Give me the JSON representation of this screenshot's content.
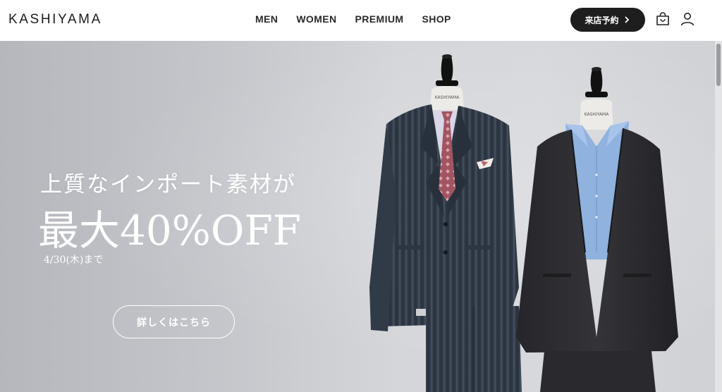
{
  "header": {
    "logo": "KASHIYAMA",
    "nav": [
      "MEN",
      "WOMEN",
      "PREMIUM",
      "SHOP"
    ],
    "reserve_label": "来店予約",
    "icons": [
      "chevron-right-icon",
      "shopping-bag-icon",
      "user-icon"
    ]
  },
  "hero": {
    "headline": "上質なインポート素材が",
    "offer": "最大40%OFF",
    "deadline": "4/30(木)まで",
    "cta_label": "詳しくはこちら",
    "mannequin_label_1": "KASHIYAMA",
    "mannequin_label_2": "KASHIYAMA"
  },
  "colors": {
    "accent_dark": "#1e1e1e",
    "hero_bg": "#cfd1d5",
    "text_white": "#ffffff"
  }
}
